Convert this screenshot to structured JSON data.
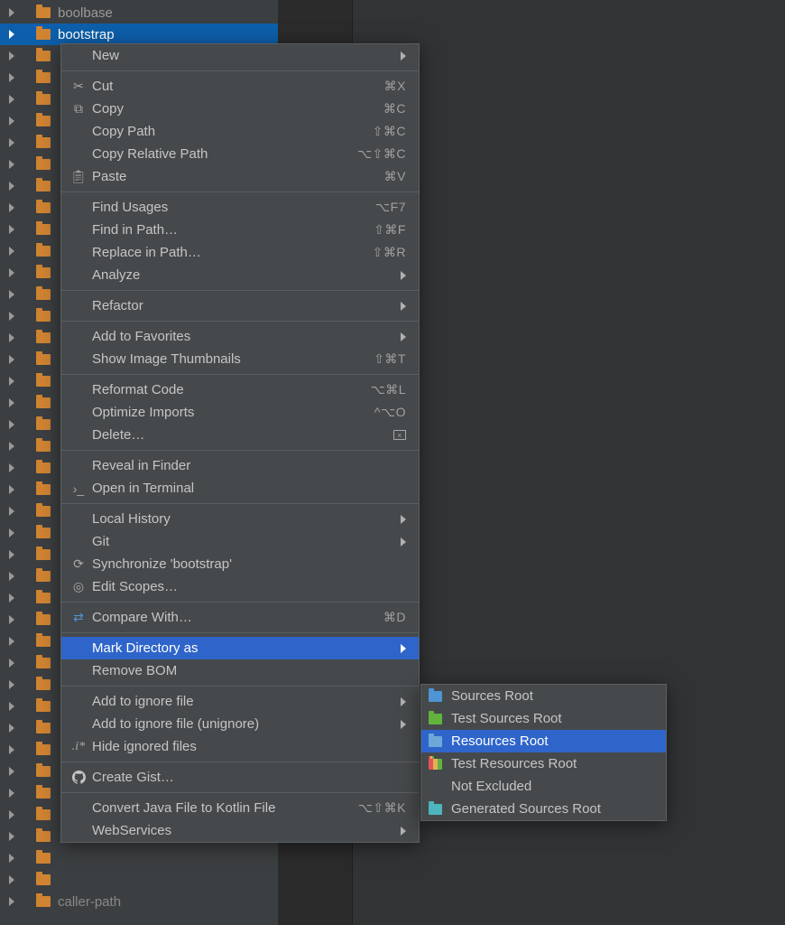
{
  "tree": {
    "items": [
      {
        "label": "boolbase"
      },
      {
        "label": "bootstrap"
      },
      {
        "label": ""
      },
      {
        "label": ""
      },
      {
        "label": ""
      },
      {
        "label": ""
      },
      {
        "label": ""
      },
      {
        "label": ""
      },
      {
        "label": ""
      },
      {
        "label": ""
      },
      {
        "label": ""
      },
      {
        "label": ""
      },
      {
        "label": ""
      },
      {
        "label": ""
      },
      {
        "label": ""
      },
      {
        "label": ""
      },
      {
        "label": ""
      },
      {
        "label": ""
      },
      {
        "label": ""
      },
      {
        "label": ""
      },
      {
        "label": ""
      },
      {
        "label": ""
      },
      {
        "label": ""
      },
      {
        "label": ""
      },
      {
        "label": ""
      },
      {
        "label": ""
      },
      {
        "label": ""
      },
      {
        "label": ""
      },
      {
        "label": ""
      },
      {
        "label": ""
      },
      {
        "label": ""
      },
      {
        "label": ""
      },
      {
        "label": ""
      },
      {
        "label": ""
      },
      {
        "label": ""
      },
      {
        "label": ""
      },
      {
        "label": ""
      },
      {
        "label": ""
      },
      {
        "label": ""
      },
      {
        "label": ""
      },
      {
        "label": ""
      },
      {
        "label": "caller-path"
      }
    ]
  },
  "menu": {
    "new": "New",
    "cut": "Cut",
    "cut_sc": "⌘X",
    "copy": "Copy",
    "copy_sc": "⌘C",
    "copy_path": "Copy Path",
    "copy_path_sc": "⇧⌘C",
    "copy_rel": "Copy Relative Path",
    "copy_rel_sc": "⌥⇧⌘C",
    "paste": "Paste",
    "paste_sc": "⌘V",
    "find_usages": "Find Usages",
    "find_usages_sc": "⌥F7",
    "find_in_path": "Find in Path…",
    "find_in_path_sc": "⇧⌘F",
    "replace_in_path": "Replace in Path…",
    "replace_in_path_sc": "⇧⌘R",
    "analyze": "Analyze",
    "refactor": "Refactor",
    "add_fav": "Add to Favorites",
    "show_thumbs": "Show Image Thumbnails",
    "show_thumbs_sc": "⇧⌘T",
    "reformat": "Reformat Code",
    "reformat_sc": "⌥⌘L",
    "optimize": "Optimize Imports",
    "optimize_sc": "^⌥O",
    "delete": "Delete…",
    "reveal": "Reveal in Finder",
    "terminal": "Open in Terminal",
    "local_history": "Local History",
    "git": "Git",
    "sync": "Synchronize 'bootstrap'",
    "edit_scopes": "Edit Scopes…",
    "compare": "Compare With…",
    "compare_sc": "⌘D",
    "mark_dir": "Mark Directory as",
    "remove_bom": "Remove BOM",
    "add_ignore": "Add to ignore file",
    "add_ignore_un": "Add to ignore file (unignore)",
    "hide_ignored": "Hide ignored files",
    "create_gist": "Create Gist…",
    "convert_kotlin": "Convert Java File to Kotlin File",
    "convert_kotlin_sc": "⌥⇧⌘K",
    "webservices": "WebServices"
  },
  "submenu": {
    "sources": "Sources Root",
    "test_sources": "Test Sources Root",
    "resources": "Resources Root",
    "test_resources": "Test Resources Root",
    "not_excluded": "Not Excluded",
    "generated": "Generated Sources Root"
  }
}
